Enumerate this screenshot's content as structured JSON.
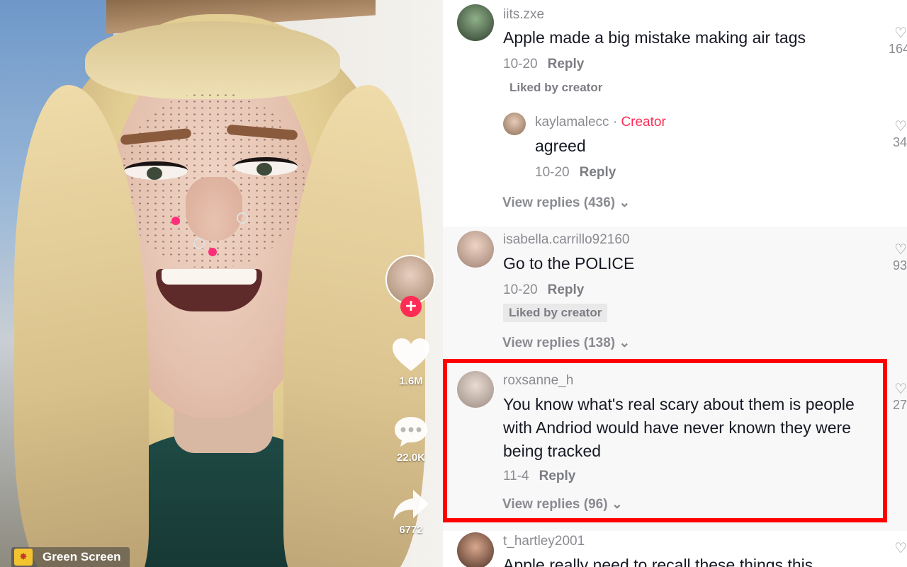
{
  "video": {
    "follow_symbol": "+",
    "likes_count": "1.6M",
    "comments_count": "22.0K",
    "shares_count": "6772",
    "effect_label": "Green Screen"
  },
  "comments": [
    {
      "username": "iits.zxe",
      "text": "Apple made a big mistake making air tags",
      "date": "10-20",
      "reply_label": "Reply",
      "liked_by_creator": "Liked by creator",
      "likes": "164",
      "replies": [
        {
          "username": "kaylamalecc",
          "separator": " · ",
          "creator_label": "Creator",
          "text": "agreed",
          "date": "10-20",
          "reply_label": "Reply",
          "likes": "34"
        }
      ],
      "view_replies": "View replies (436)"
    },
    {
      "username": "isabella.carrillo92160",
      "text": "Go to the POLICE",
      "date": "10-20",
      "reply_label": "Reply",
      "liked_by_creator": "Liked by creator",
      "likes": "93",
      "view_replies": "View replies (138)"
    },
    {
      "username": "roxsanne_h",
      "text_lines": [
        "You know what's real scary about them is people",
        "with Andriod would have never known they were",
        "being tracked"
      ],
      "date": "11-4",
      "reply_label": "Reply",
      "likes": "27",
      "view_replies": "View replies (96)"
    },
    {
      "username": "t_hartley2001",
      "text": "Apple really need to recall these things this"
    }
  ],
  "colors": {
    "highlight": "#ff0000",
    "creator": "#fe2c55",
    "follow": "#fe2c55"
  },
  "icons": {
    "like": "heart-icon",
    "comment": "comment-dots-icon",
    "share": "share-arrow-icon",
    "chevron": "chevron-down-icon"
  }
}
